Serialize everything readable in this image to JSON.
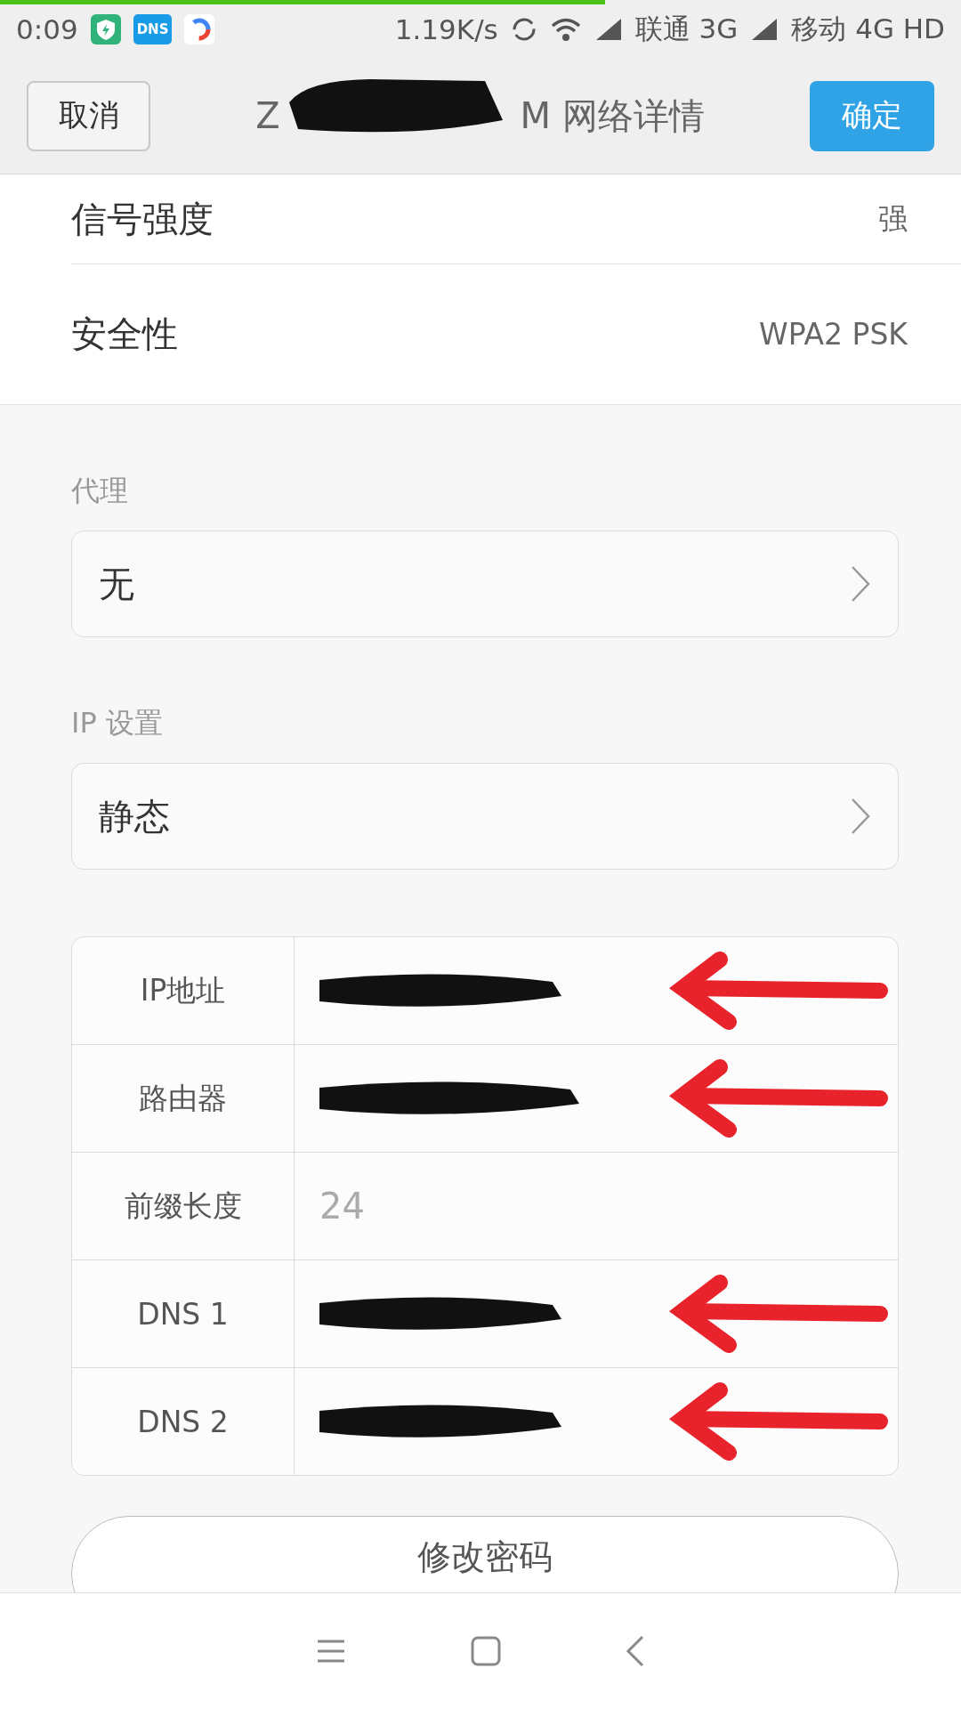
{
  "status_bar": {
    "time": "0:09",
    "dns_badge": "DNS",
    "speed": "1.19K/s",
    "carrier_1": "联通 3G",
    "carrier_2": "移动 4G HD",
    "load_progress": {
      "level": 0.63
    }
  },
  "header": {
    "cancel": "取消",
    "title_start": "Z",
    "title_end": "M  网络详情",
    "title_redacted": true,
    "confirm": "确定"
  },
  "info_rows": [
    {
      "label": "信号强度",
      "value": "强"
    },
    {
      "label": "安全性",
      "value": "WPA2 PSK"
    }
  ],
  "proxy": {
    "label": "代理",
    "value": "无"
  },
  "ip_settings": {
    "label": "IP 设置",
    "value": "静态"
  },
  "ip_table": [
    {
      "label": "IP地址",
      "redacted": true,
      "arrow": true
    },
    {
      "label": "路由器",
      "redacted": true,
      "arrow": true
    },
    {
      "label": "前缀长度",
      "value": "24",
      "redacted": false,
      "arrow": false
    },
    {
      "label": "DNS 1",
      "redacted": true,
      "arrow": true
    },
    {
      "label": "DNS 2",
      "redacted": true,
      "arrow": true
    }
  ],
  "change_password": "修改密码"
}
